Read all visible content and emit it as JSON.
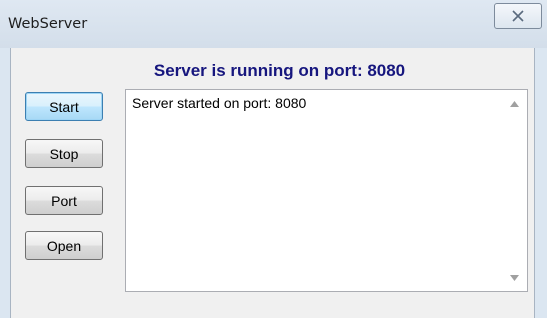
{
  "window": {
    "title": "WebServer"
  },
  "status": {
    "message": "Server is running on port: 8080"
  },
  "buttons": {
    "start": "Start",
    "stop": "Stop",
    "port": "Port",
    "open": "Open"
  },
  "log": {
    "text": "Server started on port: 8080"
  },
  "icons": {
    "close": "close-icon",
    "scroll_up": "scroll-up-arrow-icon",
    "scroll_down": "scroll-down-arrow-icon"
  },
  "colors": {
    "status_text": "#16167e",
    "focused_button_border": "#3c7fb1"
  }
}
